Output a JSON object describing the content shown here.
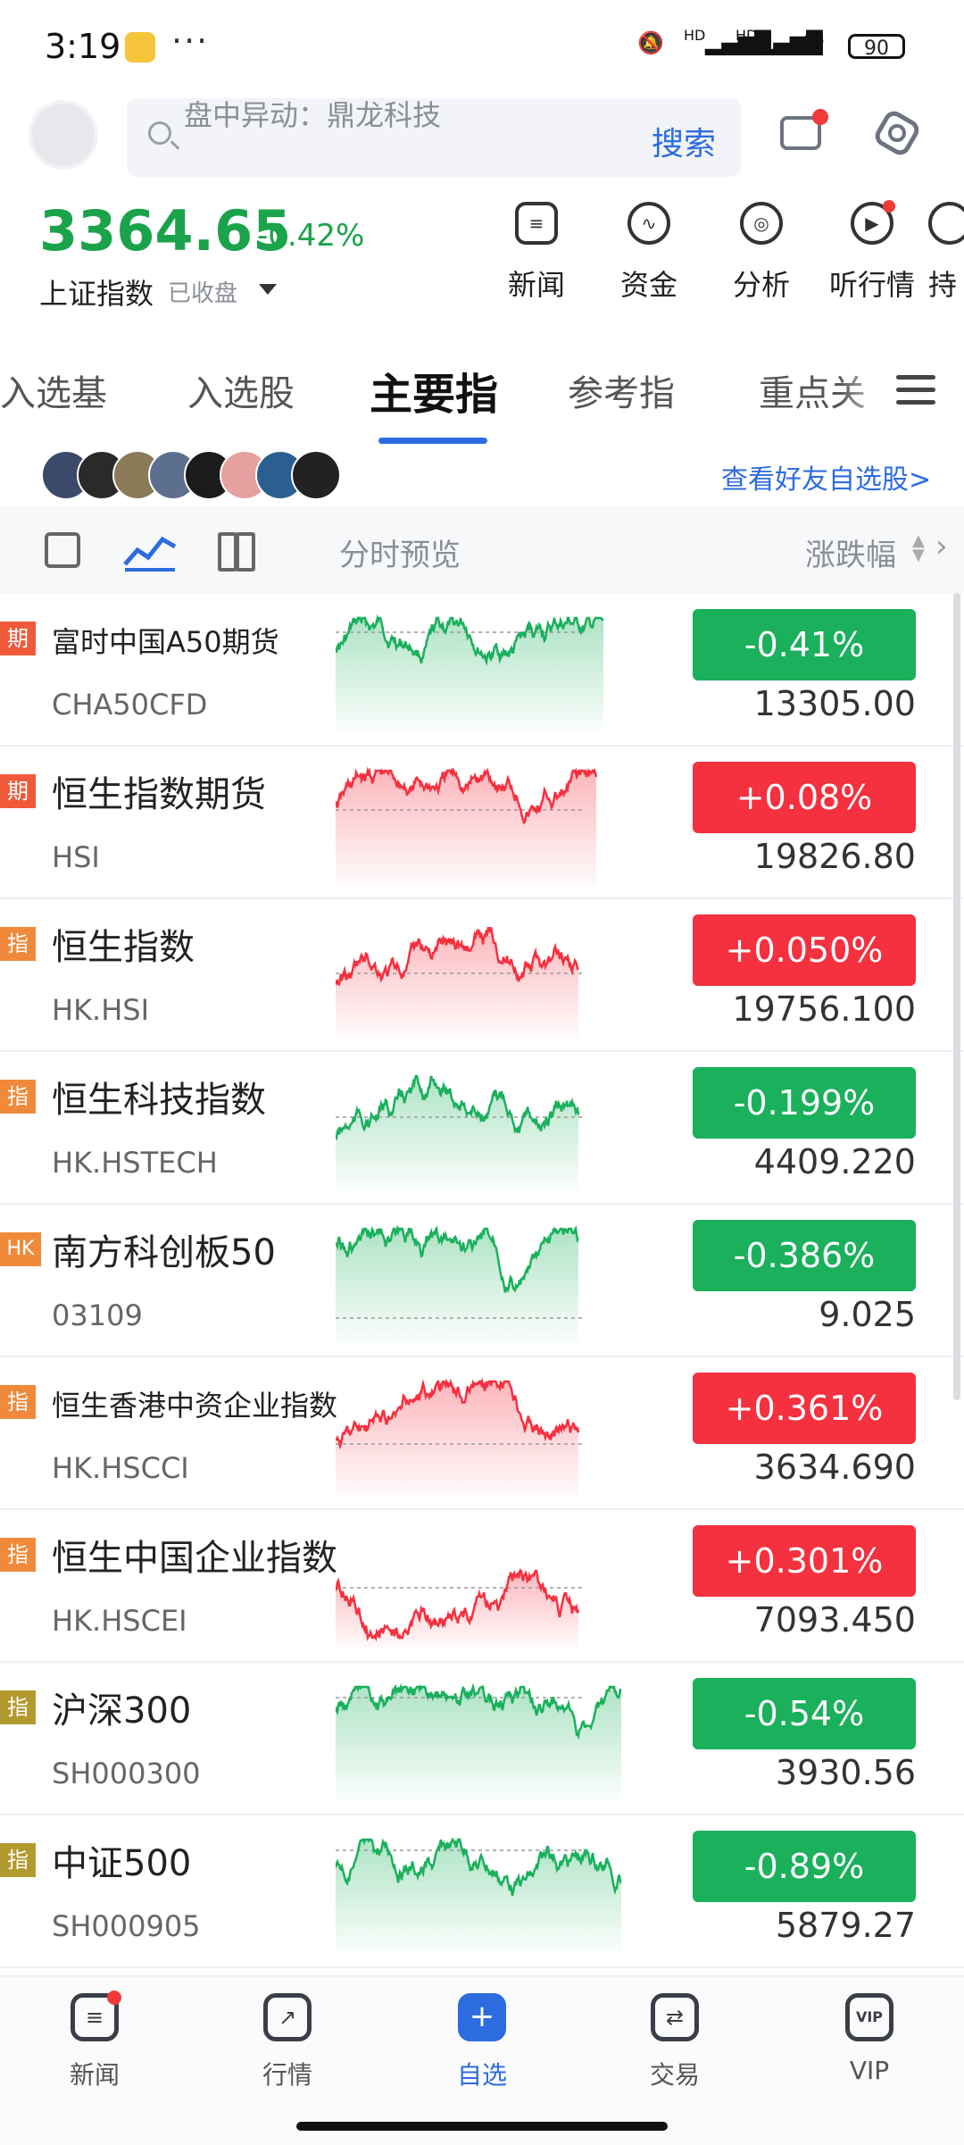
{
  "status_bar": {
    "time": "3:19",
    "dots": "···",
    "sig1": "HD",
    "sig2": "HD",
    "battery": "90"
  },
  "header": {
    "search_placeholder": "盘中异动：鼎龙科技",
    "search_button": "搜索"
  },
  "index": {
    "value": "3364.65",
    "change": "-0.42%",
    "name": "上证指数",
    "status": "已收盘"
  },
  "quick_actions": [
    {
      "label": "新闻"
    },
    {
      "label": "资金"
    },
    {
      "label": "分析"
    },
    {
      "label": "听行情"
    },
    {
      "label": "持"
    }
  ],
  "tabs": [
    {
      "label": "入选基"
    },
    {
      "label": "入选股"
    },
    {
      "label": "主要指"
    },
    {
      "label": "参考指"
    },
    {
      "label": "重点关"
    }
  ],
  "friends": {
    "link": "查看好友自选股>"
  },
  "toolbar": {
    "preview": "分时预览",
    "sort": "涨跌幅"
  },
  "rows": [
    {
      "tag": "期",
      "name": "富时中国A50期货",
      "code": "CHA50CFD",
      "change": "-0.41%",
      "price": "13305.00",
      "dir": "down"
    },
    {
      "tag": "期",
      "name": "恒生指数期货",
      "code": "HSI",
      "change": "+0.08%",
      "price": "19826.80",
      "dir": "up"
    },
    {
      "tag": "指",
      "name": "恒生指数",
      "code": "HK.HSI",
      "change": "+0.050%",
      "price": "19756.100",
      "dir": "up"
    },
    {
      "tag": "指",
      "name": "恒生科技指数",
      "code": "HK.HSTECH",
      "change": "-0.199%",
      "price": "4409.220",
      "dir": "down"
    },
    {
      "tag": "HK",
      "name": "南方科创板50",
      "code": "03109",
      "change": "-0.386%",
      "price": "9.025",
      "dir": "down"
    },
    {
      "tag": "指",
      "name": "恒生香港中资企业指数",
      "code": "HK.HSCCI",
      "change": "+0.361%",
      "price": "3634.690",
      "dir": "up"
    },
    {
      "tag": "指",
      "name": "恒生中国企业指数",
      "code": "HK.HSCEI",
      "change": "+0.301%",
      "price": "7093.450",
      "dir": "up"
    },
    {
      "tag": "指",
      "name": "沪深300",
      "code": "SH000300",
      "change": "-0.54%",
      "price": "3930.56",
      "dir": "down"
    },
    {
      "tag": "指",
      "name": "中证500",
      "code": "SH000905",
      "change": "-0.89%",
      "price": "5879.27",
      "dir": "down"
    }
  ],
  "bottom_nav": [
    {
      "label": "新闻"
    },
    {
      "label": "行情"
    },
    {
      "label": "自选"
    },
    {
      "label": "交易"
    },
    {
      "label": "VIP"
    }
  ],
  "colors": {
    "up": "#f5303f",
    "down": "#1ab05c",
    "accent": "#2d6cdf"
  }
}
